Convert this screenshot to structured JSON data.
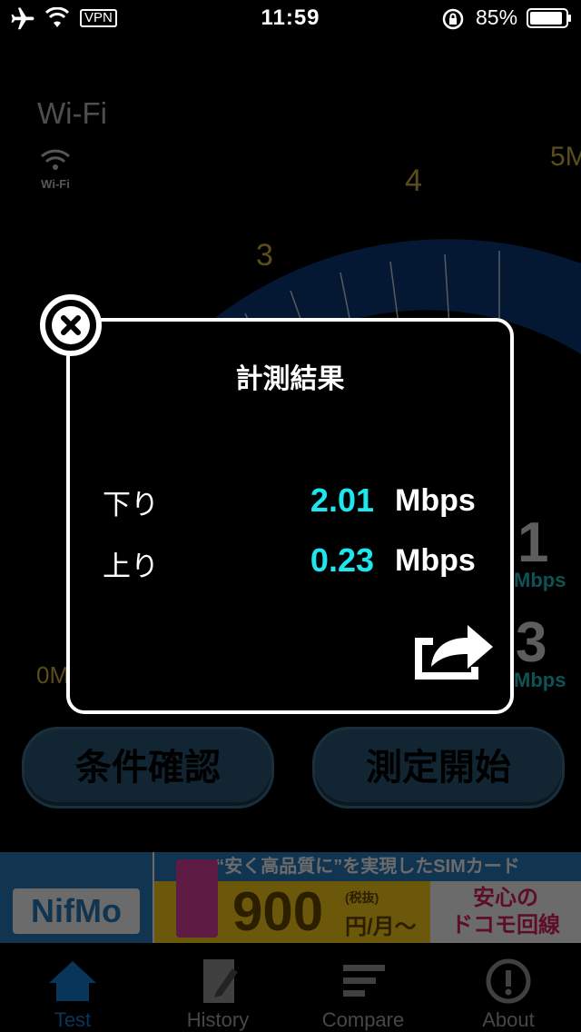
{
  "status_bar": {
    "time": "11:59",
    "vpn": "VPN",
    "battery": "85%"
  },
  "background": {
    "network_type": "Wi-Fi",
    "wifi_icon_label": "Wi-Fi",
    "gauge_labels": [
      "0M",
      "3",
      "4",
      "5M"
    ],
    "download_value": "1",
    "download_unit": "Mbps",
    "upload_value": "3",
    "upload_unit": "Mbps",
    "settings_button": "条件確認",
    "start_button": "測定開始"
  },
  "banner": {
    "logo": "NifMo",
    "tagline": "“安く高品質に”を実現したSIMカード",
    "price": "900",
    "price_note": "(税抜)",
    "price_unit": "円/月〜",
    "side_line1": "安心の",
    "side_line2": "ドコモ回線"
  },
  "tabs": [
    {
      "label": "Test",
      "icon": "house-icon",
      "active": true
    },
    {
      "label": "History",
      "icon": "notebook-pen-icon",
      "active": false
    },
    {
      "label": "Compare",
      "icon": "bars-icon",
      "active": false
    },
    {
      "label": "About",
      "icon": "info-icon",
      "active": false
    }
  ],
  "modal": {
    "title": "計測結果",
    "down_label": "下り",
    "down_value": "2.01",
    "down_unit": "Mbps",
    "up_label": "上り",
    "up_value": "0.23",
    "up_unit": "Mbps",
    "share_icon": "share-icon",
    "close_icon": "close-icon"
  },
  "colors": {
    "accent_value": "#1ee6ee",
    "tab_active": "#1a7fd8",
    "button_fill": "#2c5a78"
  }
}
